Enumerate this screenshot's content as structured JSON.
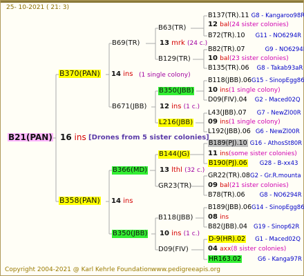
{
  "header": {
    "date": "25- 10-2021 ( 21: 3)"
  },
  "footer": {
    "copyright": "Copyright 2004-2021 @ Karl Kehrle Foundation",
    "website": "www.pedigreeapis.org"
  },
  "root": {
    "name": "B21(PAN)",
    "gen_num": "16",
    "gen_unit": "ins",
    "note": "[Drones from 5 sister colonies]"
  },
  "sire": {
    "name": "B370(PAN)",
    "gen_num": "14",
    "gen_unit": "ins",
    "note": "(1 single colony)",
    "sire": {
      "name": "B69(TR)",
      "gen_num": "13",
      "gen_unit": "mrk",
      "note": "(24 c.)",
      "sire": {
        "name": "B63(TR)"
      },
      "dam": {
        "name": "B129(TR)"
      }
    },
    "dam": {
      "name": "B671(JBB)",
      "gen_num": "12",
      "gen_unit": "ins",
      "note": "(1 c.)",
      "sire": {
        "name": "B350(JBB)"
      },
      "dam": {
        "name": "L216(JBB)"
      }
    }
  },
  "dam": {
    "name": "B358(PAN)",
    "gen_num": "14",
    "gen_unit": "ins",
    "sire": {
      "name": "B366(MD)",
      "gen_num": "13",
      "gen_unit": "lthl",
      "note": "(32 c.)",
      "sire": {
        "name": "B144(JG)"
      },
      "dam": {
        "name": "GR23(TR)"
      }
    },
    "dam": {
      "name": "B350(JBB)",
      "gen_num": "10",
      "gen_unit": "ins",
      "note": "(1 c.)",
      "sire": {
        "name": "B118(JBB)"
      },
      "dam": {
        "name": "D09(FIV)"
      }
    }
  },
  "gen5": [
    {
      "sire": "B137(TR).11",
      "sire_code": "G8 - Kangaroo98R",
      "num": "12",
      "unit": "bal",
      "note": "(24 sister colonies)",
      "dam": "B72(TR).10",
      "dam_code": "G11 - NO6294R"
    },
    {
      "sire": "B82(TR).07",
      "sire_code": "G9 - NO6294R",
      "num": "10",
      "unit": "bal",
      "note": "(23 sister colonies)",
      "dam": "B135(TR).06",
      "dam_code": "G8 - Takab93aR"
    },
    {
      "sire": "B118(JBB).06",
      "sire_code": "G15 - SinopEgg86R",
      "num": "10",
      "unit": "ins",
      "note": "(1 single colony)",
      "dam": "D09(FIV).04",
      "dam_code": "G2 - Maced02Q"
    },
    {
      "sire": "L43(JBB).07",
      "sire_code": "G7 - NewZl00R",
      "num": "09",
      "unit": "ins",
      "note": "(1 single colony)",
      "dam": "L192(JBB).06",
      "dam_code": "G6 - NewZl00R"
    },
    {
      "sire": "B189(PJ).10",
      "sire_code": "G16 - AthosSt80R",
      "num": "11",
      "unit": "ins",
      "note": "(some sister colonies)",
      "dam": "B190(PJ).06",
      "dam_code": "G28 - B-xx43"
    },
    {
      "sire": "GR22(TR).08",
      "sire_code": "G2 - Gr.R.mounta",
      "num": "09",
      "unit": "bal",
      "note": "(21 sister colonies)",
      "dam": "B78(TR).06",
      "dam_code": "G8 - NO6294R"
    },
    {
      "sire": "B189(JBB).06",
      "sire_code": "G14 - SinopEgg86R",
      "num": "08",
      "unit": "ins",
      "note": "",
      "dam": "B82(JBB).04",
      "dam_code": "G19 - Sinop62R"
    },
    {
      "sire": "D-9(HR).02",
      "sire_code": "G1 - Maced02Q",
      "num": "04",
      "unit": "axx",
      "note": "(8 sister colonies)",
      "dam": "HR163.02",
      "dam_code": "G6 - Kanga97R"
    }
  ]
}
